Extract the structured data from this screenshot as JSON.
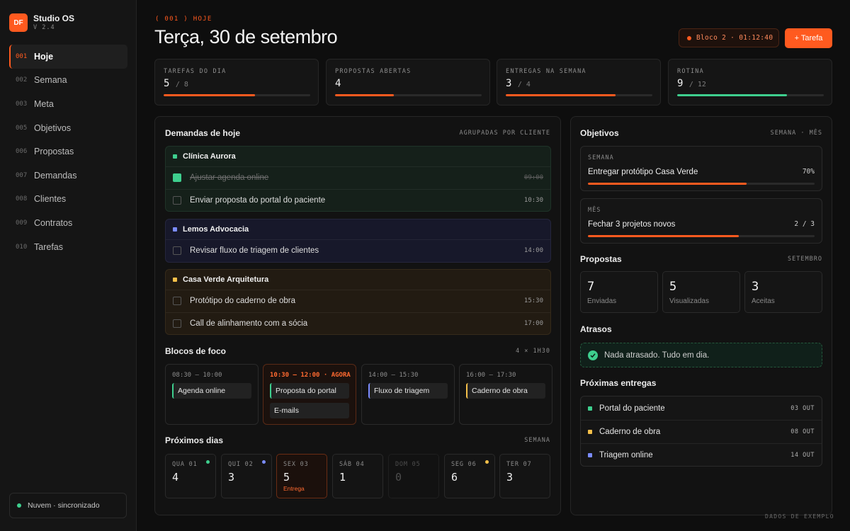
{
  "brand": {
    "logo": "DF",
    "name": "Studio OS",
    "version": "V 2.4"
  },
  "nav": [
    {
      "num": "001",
      "label": "Hoje",
      "active": true
    },
    {
      "num": "002",
      "label": "Semana"
    },
    {
      "num": "003",
      "label": "Meta"
    },
    {
      "num": "005",
      "label": "Objetivos"
    },
    {
      "num": "006",
      "label": "Propostas"
    },
    {
      "num": "007",
      "label": "Demandas"
    },
    {
      "num": "008",
      "label": "Clientes"
    },
    {
      "num": "009",
      "label": "Contratos"
    },
    {
      "num": "010",
      "label": "Tarefas"
    }
  ],
  "sync": {
    "label": "Nuvem · sincronizado",
    "color": "#3ecf8e"
  },
  "header": {
    "eyebrow": "( 001 ) HOJE",
    "title": "Terça, 30 de setembro",
    "bloco": "Bloco 2 · 01:12:40",
    "add_button": "+ Tarefa",
    "accent": "#ff5a1f"
  },
  "stats": [
    {
      "label": "TAREFAS DO DIA",
      "value": "5",
      "total": "/ 8",
      "progress": 0.625,
      "color": "#ff5a1f"
    },
    {
      "label": "PROPOSTAS ABERTAS",
      "value": "4",
      "total": "",
      "progress": 0.4,
      "color": "#ff5a1f"
    },
    {
      "label": "ENTREGAS NA SEMANA",
      "value": "3",
      "total": "/ 4",
      "progress": 0.75,
      "color": "#ff5a1f"
    },
    {
      "label": "ROTINA",
      "value": "9",
      "total": "/ 12",
      "progress": 0.75,
      "color": "#3ecf8e"
    }
  ],
  "demandas": {
    "title": "Demandas de hoje",
    "right": "AGRUPADAS POR CLIENTE",
    "groups": [
      {
        "name": "Clínica Aurora",
        "color": "#3ecf8e",
        "tasks": [
          {
            "text": "Ajustar agenda online",
            "time": "09:00",
            "done": true
          },
          {
            "text": "Enviar proposta do portal do paciente",
            "time": "10:30",
            "done": false
          }
        ]
      },
      {
        "name": "Lemos Advocacia",
        "color": "#7b8cff",
        "tasks": [
          {
            "text": "Revisar fluxo de triagem de clientes",
            "time": "14:00",
            "done": false
          }
        ]
      },
      {
        "name": "Casa Verde Arquitetura",
        "color": "#f5c04a",
        "tasks": [
          {
            "text": "Protótipo do caderno de obra",
            "time": "15:30",
            "done": false
          },
          {
            "text": "Call de alinhamento com a sócia",
            "time": "17:00",
            "done": false
          }
        ]
      }
    ]
  },
  "foco": {
    "title": "Blocos de foco",
    "right": "4 × 1H30",
    "blocks": [
      {
        "time": "08:30 — 10:00",
        "items": [
          "Agenda online"
        ],
        "color": "#3ecf8e"
      },
      {
        "time": "10:30 — 12:00 · AGORA",
        "items": [
          "Proposta do portal",
          "E-mails"
        ],
        "color": "#3ecf8e",
        "now": true
      },
      {
        "time": "14:00 — 15:30",
        "items": [
          "Fluxo de triagem"
        ],
        "color": "#7b8cff"
      },
      {
        "time": "16:00 — 17:30",
        "items": [
          "Caderno de obra"
        ],
        "color": "#f5c04a"
      }
    ]
  },
  "dias": {
    "title": "Próximos dias",
    "right": "SEMANA",
    "days": [
      {
        "label": "QUA 01",
        "count": "4",
        "dot": "#3ecf8e"
      },
      {
        "label": "QUI 02",
        "count": "3",
        "dot": "#7b8cff"
      },
      {
        "label": "SEX 03",
        "count": "5",
        "tag": "Entrega",
        "selected": true
      },
      {
        "label": "SÁB 04",
        "count": "1"
      },
      {
        "label": "DOM 05",
        "count": "0",
        "dim": true
      },
      {
        "label": "SEG 06",
        "count": "6",
        "dot": "#f5c04a"
      },
      {
        "label": "TER 07",
        "count": "3"
      }
    ]
  },
  "objetivos": {
    "title": "Objetivos",
    "right": "SEMANA · MÊS",
    "items": [
      {
        "period": "SEMANA",
        "name": "Entregar protótipo Casa Verde",
        "progress_text": "70%",
        "progress": 0.7
      },
      {
        "period": "MÊS",
        "name": "Fechar 3 projetos novos",
        "progress_text": "2 / 3",
        "progress": 0.667
      }
    ]
  },
  "propostas": {
    "title": "Propostas",
    "right": "SETEMBRO",
    "items": [
      {
        "value": "7",
        "label": "Enviadas"
      },
      {
        "value": "5",
        "label": "Visualizadas"
      },
      {
        "value": "3",
        "label": "Aceitas"
      }
    ]
  },
  "atrasos": {
    "title": "Atrasos",
    "message": "Nada atrasado. Tudo em dia."
  },
  "entregas": {
    "title": "Próximas entregas",
    "items": [
      {
        "name": "Portal do paciente",
        "date": "03 OUT",
        "color": "#3ecf8e"
      },
      {
        "name": "Caderno de obra",
        "date": "08 OUT",
        "color": "#f5c04a"
      },
      {
        "name": "Triagem online",
        "date": "14 OUT",
        "color": "#7b8cff"
      }
    ]
  },
  "footnote": "DADOS DE EXEMPLO"
}
